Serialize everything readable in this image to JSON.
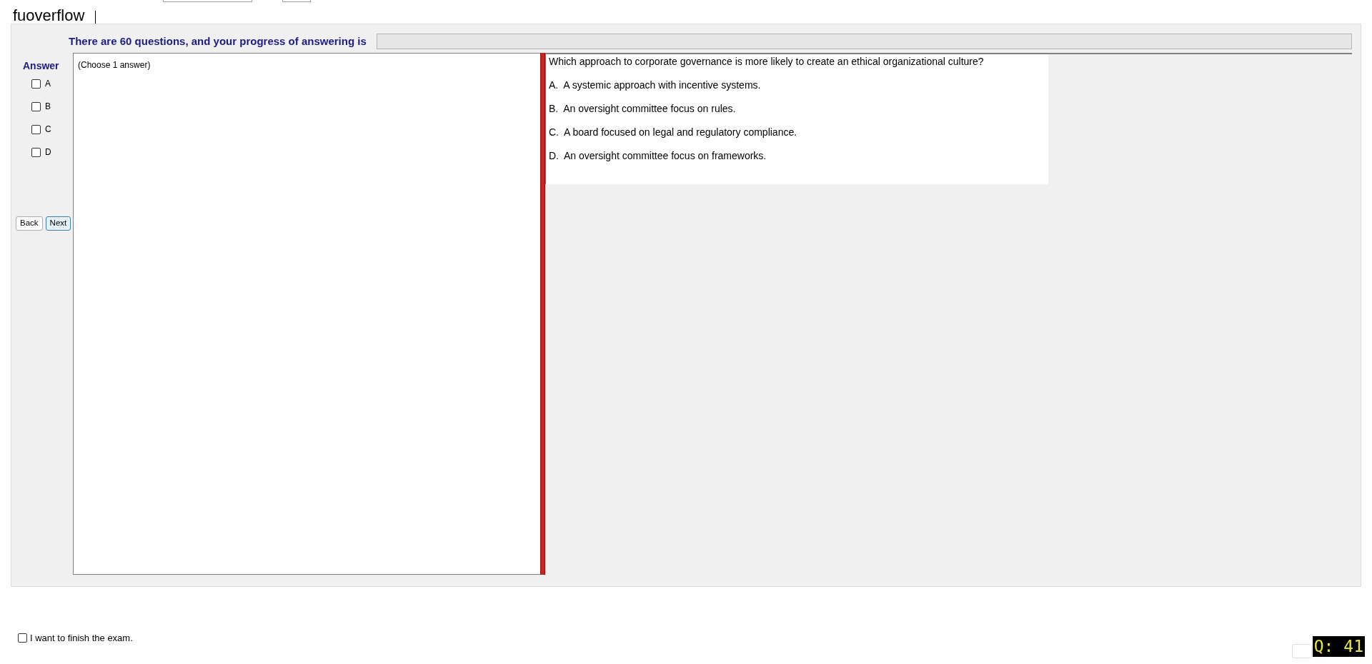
{
  "app_title": "fuoverflow",
  "progress": {
    "label": "There are 60 questions, and your progress of answering is",
    "level": 0
  },
  "answer_panel": {
    "title": "Answer",
    "options": [
      {
        "label": "A",
        "checked": false
      },
      {
        "label": "B",
        "checked": false
      },
      {
        "label": "C",
        "checked": false
      },
      {
        "label": "D",
        "checked": false
      }
    ]
  },
  "buttons": [
    {
      "label": "Back",
      "focused": false
    },
    {
      "label": "Next",
      "focused": true
    }
  ],
  "answer_note": "(Choose 1 answer)",
  "question": {
    "text": "Which approach to corporate governance is more likely to create an ethical organizational culture?",
    "choices": [
      {
        "letter": "A.",
        "text": "A systemic approach with incentive systems."
      },
      {
        "letter": "B.",
        "text": "An oversight committee focus on rules."
      },
      {
        "letter": "C.",
        "text": "A board focused on legal and regulatory compliance."
      },
      {
        "letter": "D.",
        "text": "An oversight committee focus on frameworks."
      }
    ]
  },
  "finish": {
    "label": "I want to finish the exam.",
    "checked": false
  },
  "question_counter": "Q: 41"
}
